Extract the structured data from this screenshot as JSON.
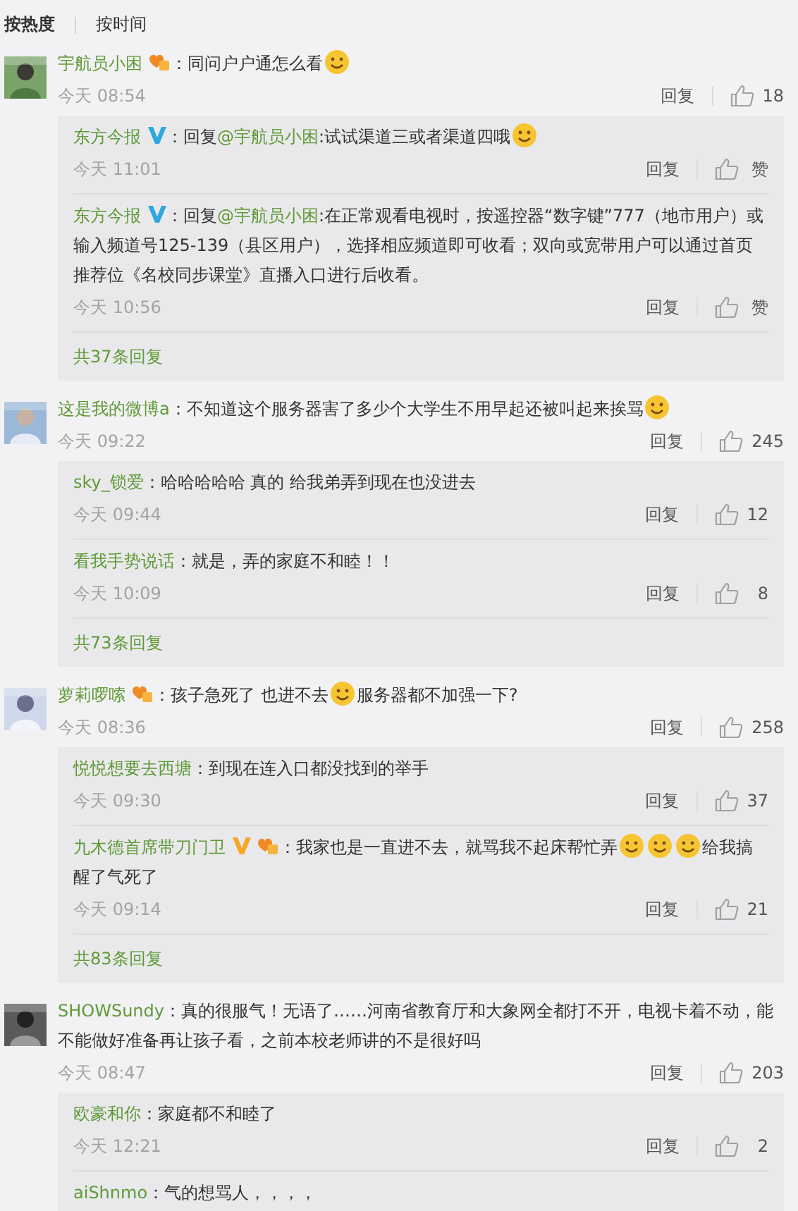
{
  "sort_tabs": [
    {
      "label": "按热度",
      "selected": true
    },
    {
      "label": "按时间",
      "selected": false
    }
  ],
  "comments": [
    {
      "user": "宇航员小困",
      "badges": [
        {
          "kind": "vip"
        }
      ],
      "content": [
        {
          "kind": "text",
          "text": "：同问户户通怎么看"
        },
        {
          "kind": "emoji"
        }
      ],
      "time": "今天 08:54",
      "reply_label": "回复",
      "likes": "18",
      "more_replies": "共37条回复",
      "replies": [
        {
          "user": "东方今报",
          "badges": [
            {
              "kind": "verified-blue"
            }
          ],
          "content": [
            {
              "kind": "text",
              "text": "：回复"
            },
            {
              "kind": "mention",
              "text": "@宇航员小困"
            },
            {
              "kind": "text",
              "text": ":试试渠道三或者渠道四哦"
            },
            {
              "kind": "emoji"
            }
          ],
          "time": "今天 11:01",
          "reply_label": "回复",
          "likes": "赞"
        },
        {
          "user": "东方今报",
          "badges": [
            {
              "kind": "verified-blue"
            }
          ],
          "content": [
            {
              "kind": "text",
              "text": "：回复"
            },
            {
              "kind": "mention",
              "text": "@宇航员小困"
            },
            {
              "kind": "text",
              "text": ":在正常观看电视时，按遥控器“数字键”777（地市用户）或输入频道号125-139（县区用户），选择相应频道即可收看；双向或宽带用户可以通过首页推荐位《名校同步课堂》直播入口进行后收看。"
            }
          ],
          "time": "今天 10:56",
          "reply_label": "回复",
          "likes": "赞"
        }
      ]
    },
    {
      "user": "这是我的微博a",
      "content": [
        {
          "kind": "text",
          "text": "：不知道这个服务器害了多少个大学生不用早起还被叫起来挨骂"
        },
        {
          "kind": "emoji"
        }
      ],
      "time": "今天 09:22",
      "reply_label": "回复",
      "likes": "245",
      "more_replies": "共73条回复",
      "replies": [
        {
          "user": "sky_锁爱",
          "content": [
            {
              "kind": "text",
              "text": "：哈哈哈哈哈  真的  给我弟弄到现在也没进去"
            }
          ],
          "time": "今天 09:44",
          "reply_label": "回复",
          "likes": "12"
        },
        {
          "user": "看我手势说话",
          "content": [
            {
              "kind": "text",
              "text": "：就是，弄的家庭不和睦！！"
            }
          ],
          "time": "今天 10:09",
          "reply_label": "回复",
          "likes": "8"
        }
      ]
    },
    {
      "user": "萝莉啰嗦",
      "badges": [
        {
          "kind": "vip"
        }
      ],
      "content": [
        {
          "kind": "text",
          "text": "：孩子急死了 也进不去"
        },
        {
          "kind": "emoji"
        },
        {
          "kind": "text",
          "text": "服务器都不加强一下?"
        }
      ],
      "time": "今天 08:36",
      "reply_label": "回复",
      "likes": "258",
      "more_replies": "共83条回复",
      "replies": [
        {
          "user": "悦悦想要去西塘",
          "content": [
            {
              "kind": "text",
              "text": "：到现在连入口都没找到的举手"
            }
          ],
          "time": "今天 09:30",
          "reply_label": "回复",
          "likes": "37"
        },
        {
          "user": "九木德首席带刀门卫",
          "badges": [
            {
              "kind": "verified-gold"
            },
            {
              "kind": "vip"
            }
          ],
          "content": [
            {
              "kind": "text",
              "text": "：我家也是一直进不去，就骂我不起床帮忙弄"
            },
            {
              "kind": "emoji"
            },
            {
              "kind": "emoji"
            },
            {
              "kind": "emoji"
            },
            {
              "kind": "text",
              "text": "给我搞醒了气死了"
            }
          ],
          "time": "今天 09:14",
          "reply_label": "回复",
          "likes": "21"
        }
      ]
    },
    {
      "user": "SHOWSundy",
      "content": [
        {
          "kind": "text",
          "text": "：真的很服气！无语了……河南省教育厅和大象网全都打不开，电视卡着不动，能不能做好准备再让孩子看，之前本校老师讲的不是很好吗"
        }
      ],
      "time": "今天 08:47",
      "reply_label": "回复",
      "likes": "203",
      "replies": [
        {
          "user": "欧豪和你",
          "content": [
            {
              "kind": "text",
              "text": "：家庭都不和睦了"
            }
          ],
          "time": "今天 12:21",
          "reply_label": "回复",
          "likes": "2"
        },
        {
          "user": "aiShnmo",
          "content": [
            {
              "kind": "text",
              "text": "：气的想骂人，，，，"
            }
          ]
        }
      ]
    }
  ]
}
